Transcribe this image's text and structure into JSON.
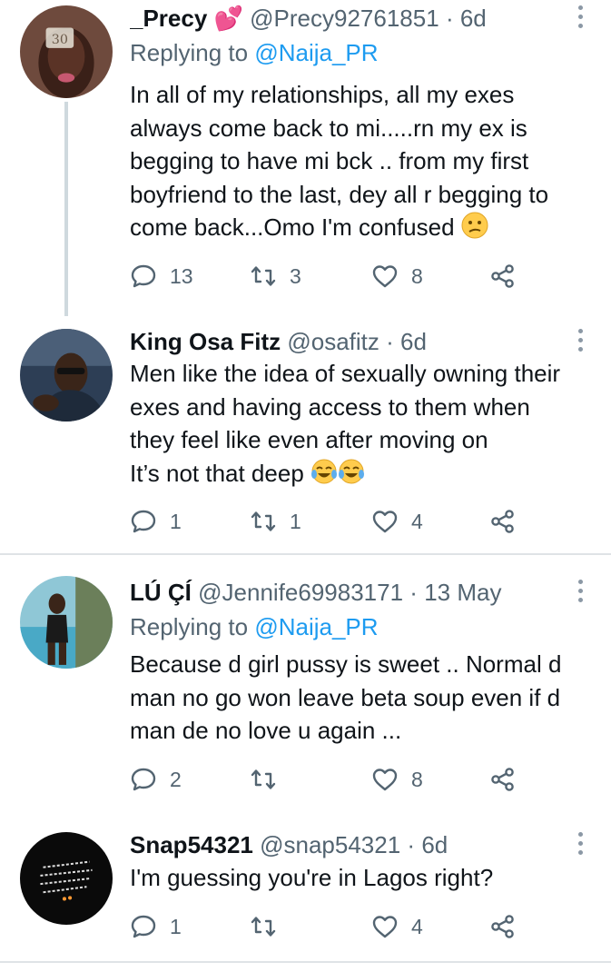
{
  "tweets": [
    {
      "name": "_Precy",
      "name_emoji": "💕",
      "handle": "@Precy92761851",
      "sep": "·",
      "time": "6d",
      "replying_prefix": "Replying to",
      "replying_to": "@Naija_PR",
      "text": "In all of my relationships, all my exes\nalways come back to mi.....rn my ex is\nbegging to have mi bck .. from my first\nboyfriend to the last, dey all r begging to\ncome back...Omo I'm confused",
      "text_emoji": "confused-face",
      "replies": "13",
      "retweets": "3",
      "likes": "8"
    },
    {
      "name": "King Osa Fitz",
      "handle": "@osafitz",
      "sep": "·",
      "time": "6d",
      "text": "Men like the idea of sexually owning their\nexes and having access to them when\nthey feel like even after moving on\nIt’s not that deep",
      "text_emoji": "tears-of-joy",
      "replies": "1",
      "retweets": "1",
      "likes": "4"
    },
    {
      "name": "LÚ ÇÍ",
      "handle": "@Jennife69983171",
      "sep": "·",
      "time": "13 May",
      "replying_prefix": "Replying to",
      "replying_to": "@Naija_PR",
      "text": "Because d girl pussy is sweet .. Normal d\nman no go won leave beta soup even if d\nman de no love u again ...",
      "replies": "2",
      "retweets": "",
      "likes": "8"
    },
    {
      "name": "Snap54321",
      "handle": "@snap54321",
      "sep": "·",
      "time": "6d",
      "text": "I'm guessing you're in Lagos right?",
      "replies": "1",
      "retweets": "",
      "likes": "4"
    }
  ],
  "colors": {
    "text": "#0f1419",
    "secondary": "#536471",
    "link": "#1d9bf0",
    "divider": "#dfe3e6",
    "thread_line": "#cfd9de"
  },
  "icons": [
    "reply-icon",
    "retweet-icon",
    "like-icon",
    "share-icon",
    "more-icon"
  ]
}
